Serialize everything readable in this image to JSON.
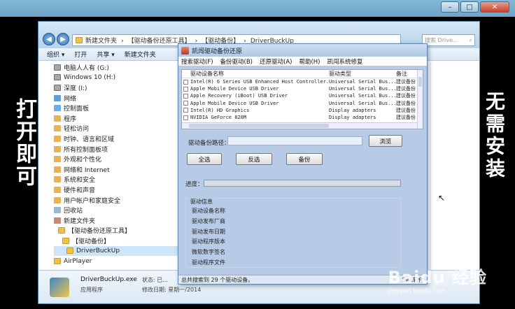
{
  "side_text_left": "打开即可",
  "side_text_right": "无需安装",
  "explorer": {
    "breadcrumb": [
      "新建文件夹",
      "【驱动备份还原工具】",
      "【驱动备份】",
      "DriverBuckUp"
    ],
    "search_placeholder": "搜索 Drive...",
    "toolbar": [
      "组织 ▾",
      "打开",
      "共享 ▾",
      "新建文件夹"
    ],
    "tree": [
      {
        "label": "电脑人人有 (G:)",
        "icon": "drive-icon",
        "kind": "drive"
      },
      {
        "label": "Windows 10 (H:)",
        "icon": "drive-icon",
        "kind": "drive"
      },
      {
        "label": "深度 (I:)",
        "icon": "drive-icon",
        "kind": "drive"
      },
      {
        "label": "网络",
        "icon": "network-icon",
        "kind": "net"
      },
      {
        "label": "控制面板",
        "icon": "control-panel-icon",
        "kind": "cp"
      },
      {
        "label": "程序",
        "icon": "programs-icon",
        "kind": "sub"
      },
      {
        "label": "轻松访问",
        "icon": "ease-of-access-icon",
        "kind": "sub"
      },
      {
        "label": "时钟、语言和区域",
        "icon": "clock-icon",
        "kind": "sub"
      },
      {
        "label": "所有控制面板项",
        "icon": "control-panel-items-icon",
        "kind": "sub"
      },
      {
        "label": "外观和个性化",
        "icon": "appearance-icon",
        "kind": "sub"
      },
      {
        "label": "网络和 Internet",
        "icon": "network-internet-icon",
        "kind": "sub"
      },
      {
        "label": "系统和安全",
        "icon": "security-icon",
        "kind": "sub"
      },
      {
        "label": "硬件和声音",
        "icon": "hardware-icon",
        "kind": "sub"
      },
      {
        "label": "用户帐户和家庭安全",
        "icon": "user-accounts-icon",
        "kind": "sub"
      },
      {
        "label": "回收站",
        "icon": "recycle-bin-icon",
        "kind": "bin"
      },
      {
        "label": "新建文件夹",
        "icon": "user-folder-icon",
        "kind": "user"
      },
      {
        "label": "【驱动备份还原工具】",
        "icon": "folder-icon",
        "kind": "folder"
      },
      {
        "label": "【驱动备份】",
        "icon": "folder-icon",
        "kind": "folder"
      },
      {
        "label": "DriverBuckUp",
        "icon": "folder-icon",
        "kind": "folder"
      },
      {
        "label": "AirPlayer",
        "icon": "folder-icon",
        "kind": "folder"
      }
    ],
    "details": {
      "name": "DriverBuckUp.exe",
      "type": "应用程序",
      "status_label": "状态:",
      "status_value": "已...",
      "modified_label": "修改日期:",
      "modified_value": "星期一/2014"
    }
  },
  "dialog": {
    "title": "凯闯驱动备份还原",
    "menu": [
      "搜索驱动(F)",
      "备份驱动(B)",
      "还原驱动(A)",
      "帮助(H)",
      "凯闯系统修复"
    ],
    "columns": [
      "驱动设备名称",
      "驱动类型",
      "备注"
    ],
    "rows": [
      {
        "name": "Intel(R) 6 Series USB Enhanced Host Controller...",
        "type": "Universal Serial Bus...",
        "note": "建议备份"
      },
      {
        "name": "Apple Mobile Device USB Driver",
        "type": "Universal Serial Bus...",
        "note": "建议备份"
      },
      {
        "name": "Apple Recovery (iBoot) USB Driver",
        "type": "Universal Serial Bus...",
        "note": "建议备份"
      },
      {
        "name": "Apple Mobile Device USB Driver",
        "type": "Universal Serial Bus...",
        "note": "建议备份"
      },
      {
        "name": "Intel(R) HD Graphics",
        "type": "Display adapters",
        "note": "建议备份"
      },
      {
        "name": "NVIDIA GeForce 820M",
        "type": "Display adapters",
        "note": "建议备份"
      }
    ],
    "path_label": "驱动备份路径：",
    "path_value": "",
    "browse_label": "浏览",
    "select_all_label": "全选",
    "invert_label": "反选",
    "backup_label": "备份",
    "progress_label": "进度：",
    "progress_value": 0,
    "group_title": "驱动信息",
    "info_lines": [
      "驱动设备名称",
      "驱动发布厂商",
      "驱动发布日期",
      "驱动程序版本",
      "微软数字签名",
      "驱动程序文件"
    ],
    "status_left": "总共搜索到 29 个驱动设备。",
    "status_right": "BAL软件"
  },
  "watermark": {
    "main": "Baidu 经验",
    "sub": "jingyan.baidu.com"
  },
  "colors": {
    "dialog_bg": "#b7cbe6",
    "list_bg": "#ffffff",
    "accent": "#5e87b5"
  }
}
